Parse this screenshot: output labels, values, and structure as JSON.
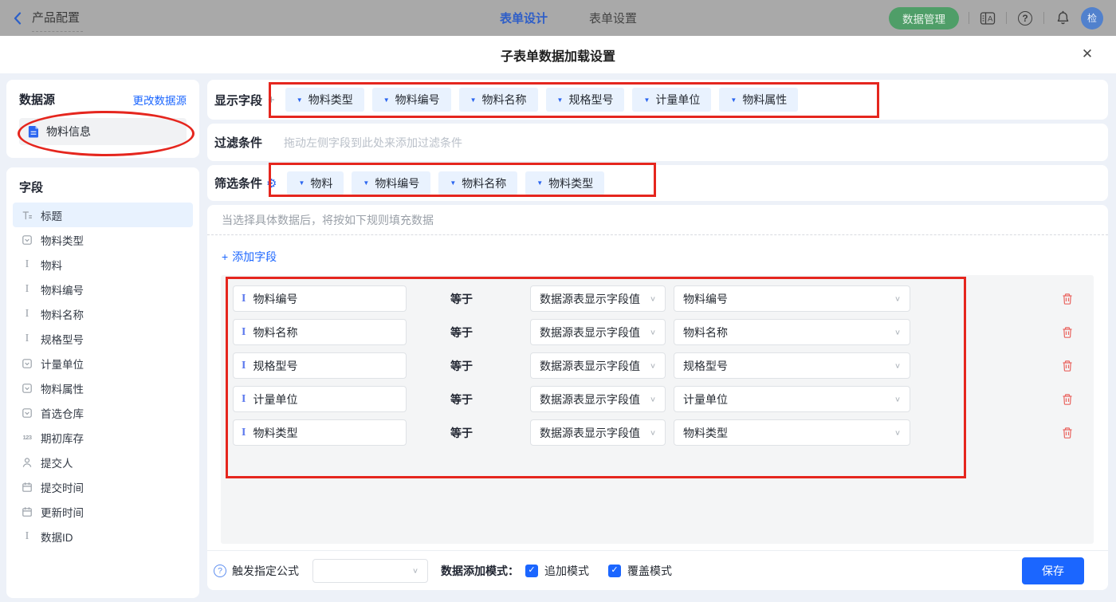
{
  "topbar": {
    "back_label": "产品配置",
    "tabs": [
      {
        "label": "表单设计",
        "active": true
      },
      {
        "label": "表单设置",
        "active": false
      }
    ],
    "data_manage_label": "数据管理",
    "avatar_text": "检"
  },
  "modal": {
    "title": "子表单数据加载设置"
  },
  "sidebar": {
    "datasource": {
      "title": "数据源",
      "change_link": "更改数据源",
      "selected": "物料信息"
    },
    "fields": {
      "title": "字段",
      "items": [
        {
          "label": "标题",
          "type": "title",
          "selected": true
        },
        {
          "label": "物料类型",
          "type": "select"
        },
        {
          "label": "物料",
          "type": "text"
        },
        {
          "label": "物料编号",
          "type": "text"
        },
        {
          "label": "物料名称",
          "type": "text"
        },
        {
          "label": "规格型号",
          "type": "text"
        },
        {
          "label": "计量单位",
          "type": "select"
        },
        {
          "label": "物料属性",
          "type": "select"
        },
        {
          "label": "首选仓库",
          "type": "select"
        },
        {
          "label": "期初库存",
          "type": "number"
        },
        {
          "label": "提交人",
          "type": "person"
        },
        {
          "label": "提交时间",
          "type": "date"
        },
        {
          "label": "更新时间",
          "type": "date"
        },
        {
          "label": "数据ID",
          "type": "text"
        }
      ]
    }
  },
  "main": {
    "display_fields": {
      "label": "显示字段",
      "tags": [
        "物料类型",
        "物料编号",
        "物料名称",
        "规格型号",
        "计量单位",
        "物料属性"
      ]
    },
    "filter": {
      "label": "过滤条件",
      "placeholder": "拖动左侧字段到此处来添加过滤条件"
    },
    "screen": {
      "label": "筛选条件",
      "tags": [
        "物料",
        "物料编号",
        "物料名称",
        "物料类型"
      ]
    },
    "rules": {
      "hint": "当选择具体数据后，将按如下规则填充数据",
      "add_field_label": "添加字段",
      "operator": "等于",
      "rows": [
        {
          "field": "物料编号",
          "source": "数据源表显示字段值",
          "value": "物料编号"
        },
        {
          "field": "物料名称",
          "source": "数据源表显示字段值",
          "value": "物料名称"
        },
        {
          "field": "规格型号",
          "source": "数据源表显示字段值",
          "value": "规格型号"
        },
        {
          "field": "计量单位",
          "source": "数据源表显示字段值",
          "value": "计量单位"
        },
        {
          "field": "物料类型",
          "source": "数据源表显示字段值",
          "value": "物料类型"
        }
      ]
    }
  },
  "footer": {
    "formula_label": "触发指定公式",
    "formula_value": "",
    "mode_label": "数据添加模式：",
    "checkboxes": [
      {
        "label": "追加模式",
        "checked": true
      },
      {
        "label": "覆盖模式",
        "checked": true
      }
    ],
    "save_label": "保存"
  },
  "icons": {
    "caret_down": "▼",
    "chevron_down": "∨",
    "close": "✕",
    "plus": "+",
    "check": "✓",
    "gear": "⚙",
    "question": "?"
  },
  "colors": {
    "accent_blue": "#1b66ff",
    "tag_bg": "#e9f2fe",
    "green_button": "#4f9e68",
    "danger_red": "#e9645f",
    "annotation_red": "#e5261e",
    "selected_item_bg": "#e8f2fe",
    "panel_gray": "#f4f5f6"
  }
}
